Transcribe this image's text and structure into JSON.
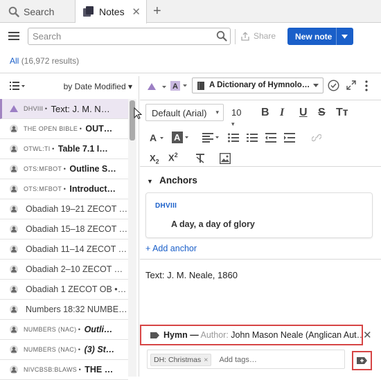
{
  "tabs": [
    {
      "label": "Search"
    },
    {
      "label": "Notes",
      "close": "✕"
    }
  ],
  "add_tab": "+",
  "toolbar": {
    "search_placeholder": "Search",
    "share_label": "Share",
    "new_note_label": "New note"
  },
  "results": {
    "scope": "All",
    "count": "(16,972 results)"
  },
  "list": {
    "sort_label": "by Date Modified",
    "rows": [
      {
        "abbr": "DHVIII",
        "sep": " • ",
        "title": "Text: J. M. N…",
        "selected": true,
        "icon": "triangle-icon"
      },
      {
        "abbr": "THE OPEN BIBLE",
        "sep": " • ",
        "title": "OUT…",
        "icon": "person-icon"
      },
      {
        "abbr": "OTWL:TI",
        "sep": " • ",
        "title": "Table 7.1 I…",
        "icon": "person-icon"
      },
      {
        "abbr": "OTS:MFBOT",
        "sep": " • ",
        "title": "Outline S…",
        "icon": "person-icon"
      },
      {
        "abbr": "OTS:MFBOT",
        "sep": " • ",
        "title": "Introduct…",
        "icon": "person-icon"
      },
      {
        "abbr": "",
        "sep": "",
        "title": "Obadiah 19–21 ZECOT …",
        "icon": "person-icon"
      },
      {
        "abbr": "",
        "sep": "",
        "title": "Obadiah 15–18 ZECOT …",
        "icon": "person-icon"
      },
      {
        "abbr": "",
        "sep": "",
        "title": "Obadiah 11–14 ZECOT …",
        "icon": "person-icon"
      },
      {
        "abbr": "",
        "sep": "",
        "title": "Obadiah 2–10 ZECOT O…",
        "icon": "person-icon"
      },
      {
        "abbr": "",
        "sep": "",
        "title": "Obadiah 1 ZECOT OB • T…",
        "icon": "person-icon"
      },
      {
        "abbr": "",
        "sep": "",
        "title": "Numbers 18:32 NUMBE…",
        "icon": "person-icon"
      },
      {
        "abbr": "NUMBERS (NAC)",
        "sep": " • ",
        "title": "Outli…",
        "icon": "person-icon"
      },
      {
        "abbr": "NUMBERS (NAC)",
        "sep": " • ",
        "title": "(3) St…",
        "icon": "person-icon"
      },
      {
        "abbr": "NIVCBSB:BLAWS",
        "sep": " • ",
        "title": "THE …",
        "icon": "person-icon"
      }
    ]
  },
  "editor": {
    "book_title": "A Dictionary of Hymnolo…",
    "font_family": "Default (Arial)",
    "font_size": "10",
    "anchors_header": "Anchors",
    "anchor_abbr": "DHVIII",
    "anchor_ref": "A day, a day of glory",
    "add_anchor": "+ Add anchor",
    "note_text": "Text: J. M. Neale, 1860",
    "hymn_label": "Hymn —",
    "hymn_author_label": "Author:",
    "hymn_author": "John Mason Neale (Anglican Aut…",
    "tag_chip": "DH: Christmas",
    "tag_placeholder": "Add tags…"
  },
  "colors": {
    "accent": "#1a5fc9",
    "highlight": "#d64545",
    "selected_row": "#ece6f2"
  }
}
